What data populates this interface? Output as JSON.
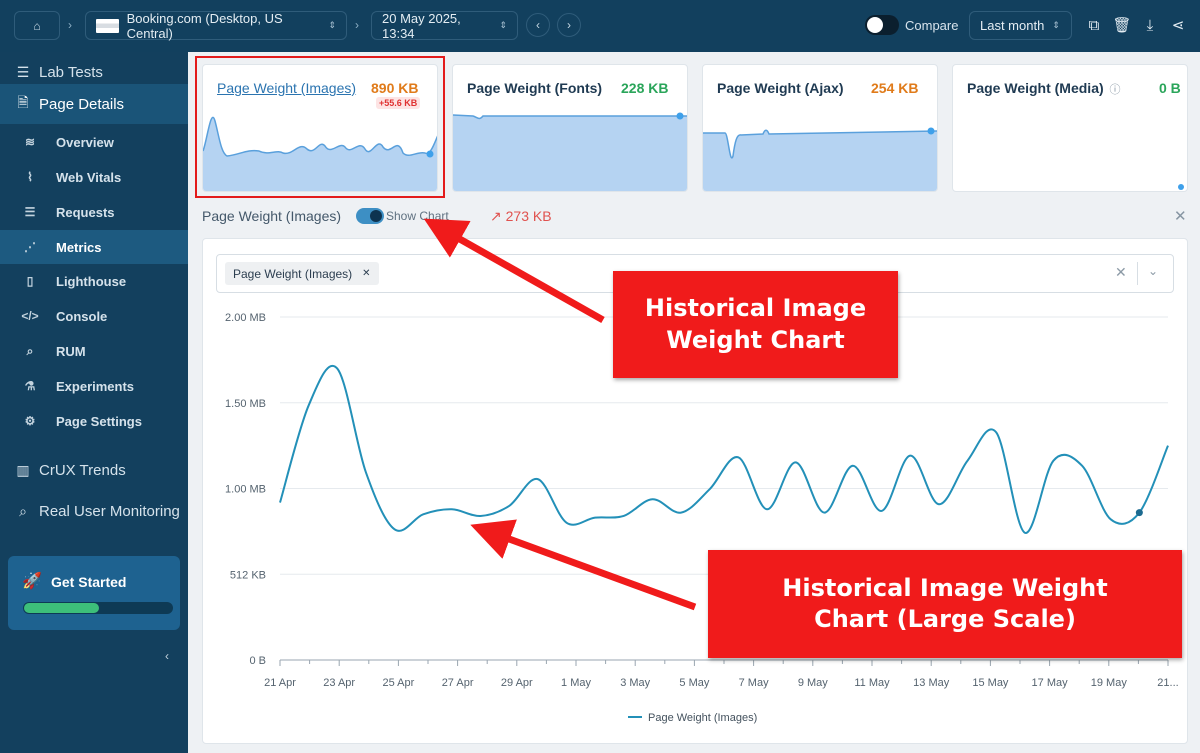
{
  "topbar": {
    "site": "Booking.com (Desktop, US Central)",
    "date": "20 May 2025, 13:34",
    "compare_label": "Compare",
    "range": "Last month"
  },
  "sidebar": {
    "items": [
      {
        "label": "Lab Tests"
      },
      {
        "label": "Page Details"
      },
      {
        "label": "Overview"
      },
      {
        "label": "Web Vitals"
      },
      {
        "label": "Requests"
      },
      {
        "label": "Metrics"
      },
      {
        "label": "Lighthouse"
      },
      {
        "label": "Console"
      },
      {
        "label": "RUM"
      },
      {
        "label": "Experiments"
      },
      {
        "label": "Page Settings"
      },
      {
        "label": "CrUX Trends"
      },
      {
        "label": "Real User Monitoring"
      }
    ],
    "get_started": {
      "label": "Get Started",
      "progress": 0.51
    }
  },
  "cards": [
    {
      "name": "Page Weight (Images)",
      "value": "890 KB",
      "delta": "+55.6 KB",
      "value_color": "#e07b1a"
    },
    {
      "name": "Page Weight (Fonts)",
      "value": "228 KB",
      "value_color": "#2aa55a"
    },
    {
      "name": "Page Weight (Ajax)",
      "value": "254 KB",
      "value_color": "#e07b1a"
    },
    {
      "name": "Page Weight (Media)",
      "value": "0 B",
      "value_color": "#2aa55a"
    }
  ],
  "detail": {
    "title": "Page Weight (Images)",
    "show_chart_label": "Show Chart",
    "trend_value": "273 KB",
    "chip_label": "Page Weight (Images)"
  },
  "annotations": {
    "callout_1": "Historical Image Weight Chart",
    "callout_2": "Historical Image Weight Chart (Large Scale)"
  },
  "colors": {
    "line": "#2390b8",
    "fill": "#b5d3f2",
    "annotation": "#f01b1b"
  },
  "chart_data": {
    "type": "line",
    "title": "",
    "xlabel": "",
    "ylabel": "",
    "y_ticks": [
      "0 B",
      "512 KB",
      "1.00 MB",
      "1.50 MB",
      "2.00 MB"
    ],
    "ylim_kb": [
      0,
      2048
    ],
    "x_tick_labels": [
      "21 Apr",
      "23 Apr",
      "25 Apr",
      "27 Apr",
      "29 Apr",
      "1 May",
      "3 May",
      "5 May",
      "7 May",
      "9 May",
      "11 May",
      "13 May",
      "15 May",
      "17 May",
      "19 May",
      "21..."
    ],
    "series": [
      {
        "name": "Page Weight (Images)",
        "x": [
          "21 Apr",
          "22 Apr",
          "23 Apr",
          "24 Apr",
          "24 Apr",
          "25 Apr",
          "26 Apr",
          "27 Apr",
          "28 Apr",
          "29 Apr",
          "30 Apr",
          "1 May",
          "2 May",
          "3 May",
          "4 May",
          "5 May",
          "6 May",
          "7 May",
          "8 May",
          "9 May",
          "10 May",
          "11 May",
          "12 May",
          "13 May",
          "14 May",
          "15 May",
          "16 May",
          "17 May",
          "18 May",
          "19 May",
          "20 May",
          "21 May"
        ],
        "values_kb": [
          940,
          1520,
          1740,
          1120,
          780,
          870,
          900,
          860,
          920,
          1080,
          820,
          850,
          860,
          960,
          880,
          1020,
          1210,
          900,
          1180,
          880,
          1160,
          890,
          1220,
          930,
          1190,
          1360,
          760,
          1190,
          1160,
          840,
          880,
          1280
        ]
      }
    ],
    "legend": "bottom-center",
    "grid": true
  }
}
